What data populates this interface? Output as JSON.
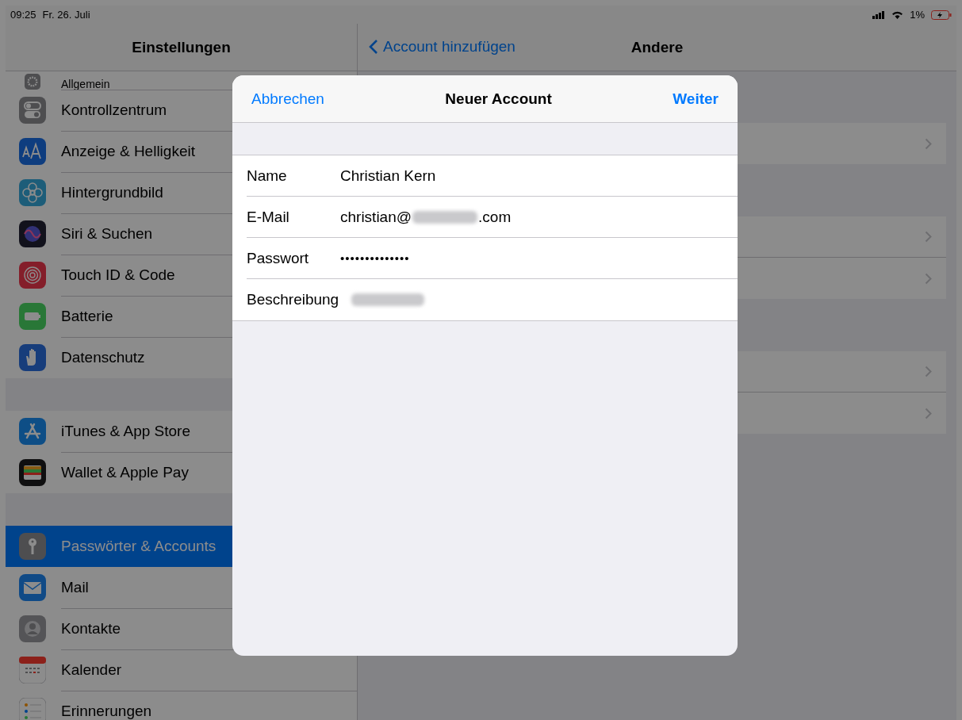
{
  "status_bar": {
    "time": "09:25",
    "date": "Fr. 26. Juli",
    "battery_text": "1%"
  },
  "sidebar": {
    "title": "Einstellungen",
    "groups": [
      {
        "items": [
          {
            "label": "Allgemein",
            "selected": false
          },
          {
            "label": "Kontrollzentrum",
            "selected": false
          },
          {
            "label": "Anzeige & Helligkeit",
            "selected": false
          },
          {
            "label": "Hintergrundbild",
            "selected": false
          },
          {
            "label": "Siri & Suchen",
            "selected": false
          },
          {
            "label": "Touch ID & Code",
            "selected": false
          },
          {
            "label": "Batterie",
            "selected": false
          },
          {
            "label": "Datenschutz",
            "selected": false
          }
        ]
      },
      {
        "items": [
          {
            "label": "iTunes & App Store",
            "selected": false
          },
          {
            "label": "Wallet & Apple Pay",
            "selected": false
          }
        ]
      },
      {
        "items": [
          {
            "label": "Passwörter & Accounts",
            "selected": true
          },
          {
            "label": "Mail",
            "selected": false
          },
          {
            "label": "Kontakte",
            "selected": false
          },
          {
            "label": "Kalender",
            "selected": false
          },
          {
            "label": "Erinnerungen",
            "selected": false
          }
        ]
      }
    ]
  },
  "detail": {
    "back_label": "Account hinzufügen",
    "title": "Andere"
  },
  "dialog": {
    "cancel": "Abbrechen",
    "title": "Neuer Account",
    "next": "Weiter",
    "fields": [
      {
        "label": "Name",
        "kind": "text",
        "value": "Christian Kern"
      },
      {
        "label": "E-Mail",
        "kind": "masked",
        "value": "christian@",
        "value_end": ".com"
      },
      {
        "label": "Passwort",
        "kind": "password",
        "value": "••••••••••••••"
      },
      {
        "label": "Beschreibung",
        "kind": "blurred"
      }
    ]
  }
}
